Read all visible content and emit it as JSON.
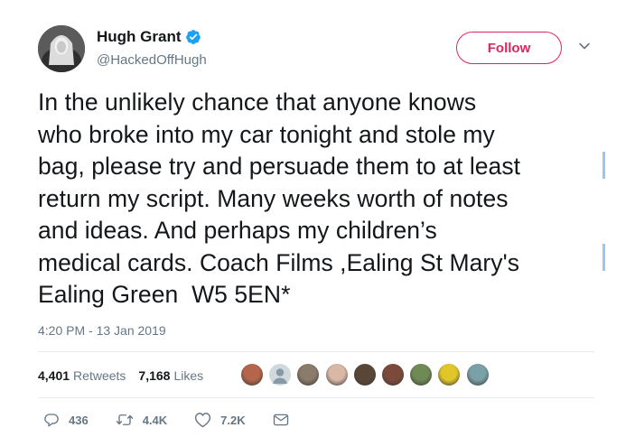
{
  "header": {
    "display_name": "Hugh Grant",
    "handle": "@HackedOffHugh",
    "follow_label": "Follow"
  },
  "tweet": {
    "text": "In the unlikely chance that anyone knows\nwho broke into my car tonight and stole my\nbag, please try and persuade them to at least\nreturn my script. Many weeks worth of notes\nand ideas. And perhaps my children’s\nmedical cards. Coach Films ,Ealing St Mary's\nEaling Green  W5 5EN*",
    "timestamp": "4:20 PM - 13 Jan 2019"
  },
  "stats": {
    "retweets_count": "4,401",
    "retweets_label": "Retweets",
    "likes_count": "7,168",
    "likes_label": "Likes"
  },
  "liker_avatars": [
    {
      "icon": "user-avatar",
      "color": "#b5654a"
    },
    {
      "icon": "default-profile",
      "color": "#cfd9de"
    },
    {
      "icon": "user-avatar",
      "color": "#8a7b6a"
    },
    {
      "icon": "user-avatar",
      "color": "#d9b8a6"
    },
    {
      "icon": "user-avatar",
      "color": "#5a4636"
    },
    {
      "icon": "user-avatar",
      "color": "#7c4a3a"
    },
    {
      "icon": "user-avatar",
      "color": "#6f8a55"
    },
    {
      "icon": "user-avatar",
      "color": "#e1c629"
    },
    {
      "icon": "user-avatar",
      "color": "#7aa0a8"
    }
  ],
  "actions": {
    "replies": "436",
    "retweets": "4.4K",
    "likes": "7.2K"
  },
  "colors": {
    "follow": "#e0245e",
    "verified": "#1da1f2",
    "muted": "#657786",
    "selection": "#9cc6ef"
  }
}
